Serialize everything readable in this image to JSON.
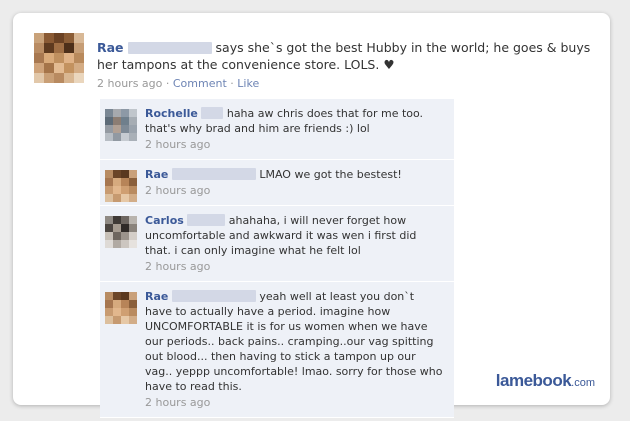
{
  "post": {
    "author": "Rae",
    "text": "says she`s got the best Hubby in the world; he goes & buys her tampons at the convenience store. LOLS. ♥",
    "time": "2 hours ago",
    "separator": "·",
    "comment_link": "Comment",
    "like_link": "Like"
  },
  "comments": [
    {
      "author": "Rochelle",
      "text": "haha aw chris does that for me too. that's why brad and him are friends :) lol",
      "time": "2 hours ago"
    },
    {
      "author": "Rae",
      "text": "LMAO we got the bestest!",
      "time": "2 hours ago"
    },
    {
      "author": "Carlos",
      "text": "ahahaha, i will never forget how uncomfortable and awkward it was wen i first did that. i can only imagine what he felt lol",
      "time": "2 hours ago"
    },
    {
      "author": "Rae",
      "text": "yeah well at least you don`t have to actually have a period. imagine how UNCOMFORTABLE it is for us women when we have our periods.. back pains.. cramping..our vag spitting out blood... then having to stick a tampon up our vag.. yeppp uncomfortable! lmao. sorry for those who have to read this.",
      "time": "2 hours ago"
    }
  ],
  "watermark": {
    "brand": "lamebook",
    "domain": ".com"
  },
  "colors": {
    "link": "#3b5998",
    "comment_bg": "#eef1f7",
    "meta": "#999999"
  }
}
